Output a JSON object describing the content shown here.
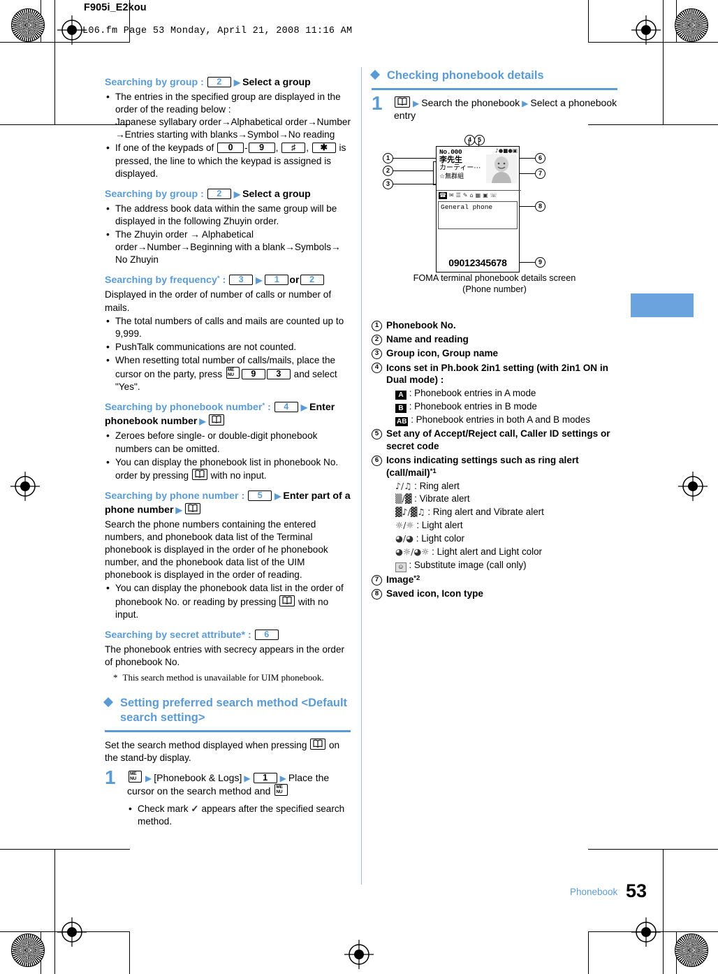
{
  "header": {
    "doc_id": "F905i_E2kou",
    "fm_line": "L06.fm  Page 53  Monday, April 21, 2008  11:16 AM"
  },
  "footer": {
    "section": "Phonebook",
    "page_number": "53"
  },
  "colors": {
    "accent": "#5b9bd5",
    "tab": "#6ba3de",
    "rule": "#5b9bd5"
  },
  "left_column": {
    "blocks": [
      {
        "heading_blue": "Searching by group : ",
        "heading_keys": [
          "2"
        ],
        "heading_black": "Select a group",
        "bullets": [
          "The entries in the specified group are displayed in the order of the reading below :\nJapanese syllabary order→Alphabetical order→Number →Entries starting with blanks→Symbol→No reading",
          "If one of the keypads of 0 - 9 , # , * is pressed, the line to which the keypad is assigned is displayed."
        ]
      },
      {
        "heading_blue": "Searching by group : ",
        "heading_keys": [
          "2"
        ],
        "heading_black": "Select a group",
        "bullets": [
          "The address book data within the same group will be displayed in the following Zhuyin order.",
          "The Zhuyin order → Alphabetical order→Number→Beginning with a blank→Symbols→ No Zhuyin"
        ]
      },
      {
        "heading_blue": "Searching by frequency",
        "heading_star": "*",
        "heading_keys": [
          "3",
          "1",
          "2"
        ],
        "heading_joiner": "or",
        "body": "Displayed in the order of number of calls or number of mails.",
        "bullets": [
          "The total numbers of calls and mails are counted up to 9,999.",
          "PushTalk communications are not counted.",
          "When resetting total number of calls/mails, place the cursor on the party, press MENU 9 3 and select \"Yes\"."
        ]
      },
      {
        "heading_blue": "Searching by phonebook number",
        "heading_star": "*",
        "heading_keys": [
          "4"
        ],
        "heading_black": "Enter phonebook number",
        "bullets": [
          "Zeroes before single- or double-digit phonebook numbers can be omitted.",
          "You can display the phonebook list in phonebook No. order by pressing (phonebook key) with no input."
        ]
      },
      {
        "heading_blue": "Searching by phone number : ",
        "heading_keys": [
          "5"
        ],
        "heading_black": "Enter part of a phone number",
        "body": "Search the phone numbers containing the entered numbers, and phonebook data list of the Terminal phonebook is displayed in the order of he phonebook number, and the phonebook data list of the UIM phonebook is displayed in the order of reading.",
        "bullets": [
          "You can display the phonebook data list in the order of phonebook No. or reading by pressing (phonebook key) with no input."
        ]
      },
      {
        "heading_blue": "Searching by secret attribute* : ",
        "heading_keys": [
          "6"
        ],
        "body": "The phonebook entries with secrecy appears in the order of phonebook No.",
        "footnote": "This search method is unavailable for UIM phonebook."
      }
    ],
    "section": {
      "title": "Setting preferred search method <Default search setting>",
      "intro_a": "Set the search method displayed when pressing",
      "intro_b": "on the stand-by display.",
      "step_number": "1",
      "step_a": "[Phonebook & Logs]",
      "step_key": "1",
      "step_b": "Place the cursor on the search method and",
      "bullet": "Check mark ✓ appears after the specified search method."
    }
  },
  "right_column": {
    "section_title": "Checking phonebook details",
    "step_number": "1",
    "step_text_a": "Search the phonebook",
    "step_text_b": "Select a phonebook entry",
    "figure": {
      "callouts": [
        "1",
        "2",
        "3",
        "4",
        "5",
        "6",
        "7",
        "8",
        "9"
      ],
      "screen": {
        "phonebook_no": "No.000",
        "name": "李先生",
        "reading": "カーティー⋯",
        "group": "無群組",
        "field_label": "General phone",
        "phone_number": "09012345678",
        "tab_icons": [
          "☎",
          "✉",
          "≡",
          "✐",
          "⌂",
          "▤",
          "▧",
          "☏"
        ],
        "status_icons": [
          "♪",
          "◔",
          "▨",
          "●",
          "▣"
        ]
      },
      "caption_line1": "FOMA terminal phonebook details screen",
      "caption_line2": "(Phone number)"
    },
    "legend": [
      {
        "num": "1",
        "text": "Phonebook No."
      },
      {
        "num": "2",
        "text": "Name and reading"
      },
      {
        "num": "3",
        "text": "Group icon, Group name"
      },
      {
        "num": "4",
        "text": "Icons set in Ph.book 2in1 setting (with 2in1 ON in Dual mode) :",
        "subs": [
          {
            "icon": "A",
            "style": "ab",
            "text": ": Phonebook entries in A mode"
          },
          {
            "icon": "B",
            "style": "ab",
            "text": ": Phonebook entries in B mode"
          },
          {
            "icon": "AB",
            "style": "ab",
            "text": ": Phonebook entries in both A and B modes"
          }
        ]
      },
      {
        "num": "5",
        "text": "Set any of Accept/Reject call, Caller ID settings or secret code"
      },
      {
        "num": "6",
        "text": "Icons indicating settings such as ring alert (call/mail)",
        "sup": "*1",
        "subs": [
          {
            "icon": "♪/♫",
            "style": "gly",
            "text": ": Ring alert"
          },
          {
            "icon": "▒/▓",
            "style": "gly",
            "text": ": Vibrate alert"
          },
          {
            "icon": "▓♪/▓♫",
            "style": "gly",
            "text": ": Ring alert and Vibrate alert"
          },
          {
            "icon": "☼/☼",
            "style": "gly",
            "text": ": Light alert"
          },
          {
            "icon": "◕/◕",
            "style": "gly",
            "text": ": Light color"
          },
          {
            "icon": "◕☼/◕☼",
            "style": "gly",
            "text": ": Light alert and Light color"
          },
          {
            "icon": "☺",
            "style": "glybox",
            "text": ": Substitute image (call only)"
          }
        ]
      },
      {
        "num": "7",
        "text": "Image",
        "sup": "*2"
      },
      {
        "num": "8",
        "text": "Saved icon, Icon type"
      }
    ]
  }
}
